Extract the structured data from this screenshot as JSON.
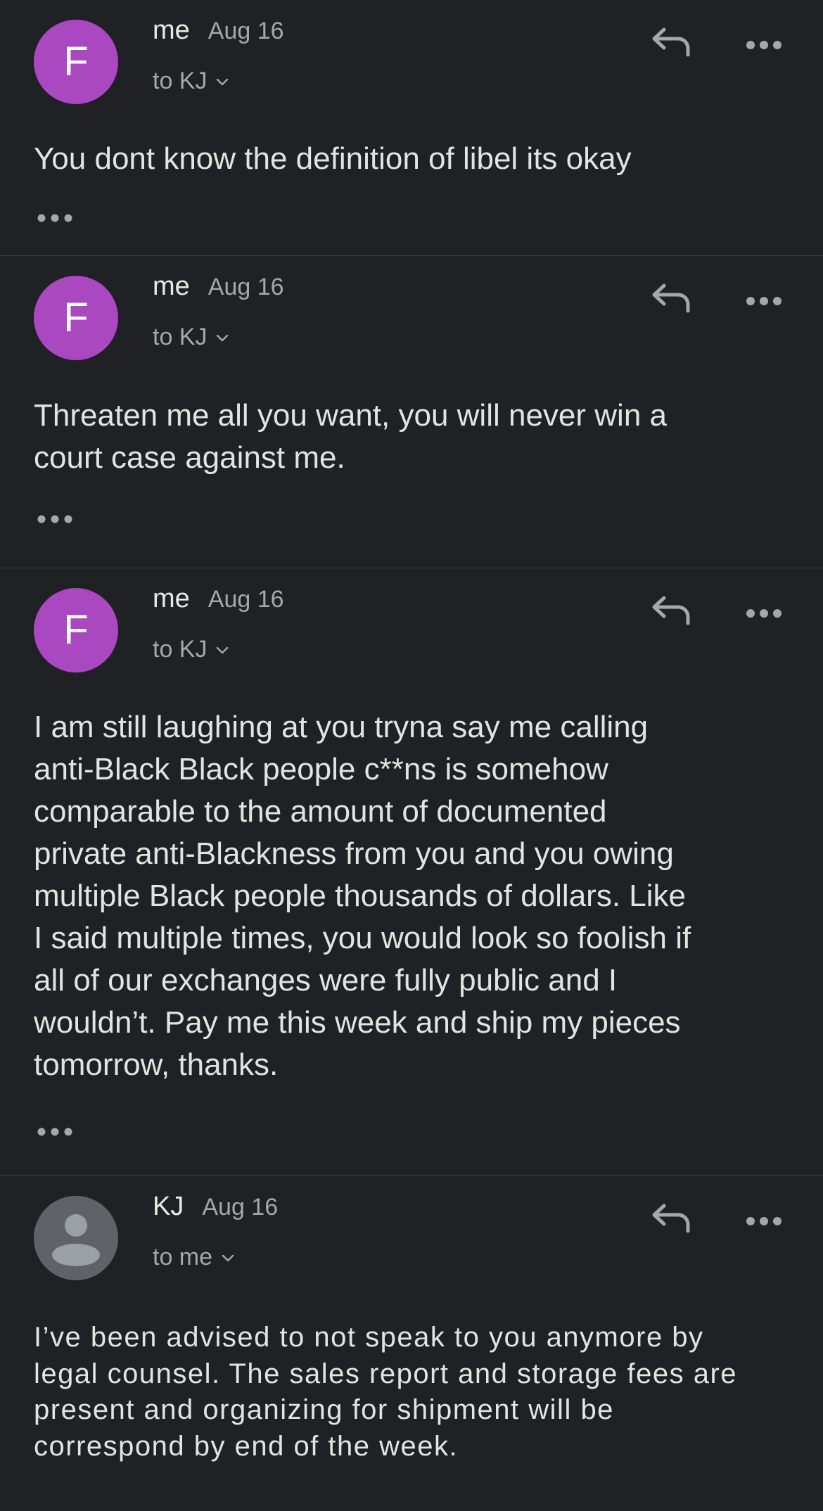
{
  "colors": {
    "background": "#202124",
    "avatar_me": "#a948c0",
    "avatar_unknown": "#5f6368",
    "divider": "#3c3d40",
    "secondary_text": "#a6a7aa"
  },
  "icons": {
    "reply": "reply-arrow-icon",
    "more": "more-horizontal-icon",
    "chevron": "chevron-down-icon",
    "expand": "show-trimmed-content-icon",
    "person": "person-silhouette-icon"
  },
  "messages": [
    {
      "avatar_letter": "F",
      "sender": "me",
      "date": "Aug 16",
      "recipient": "to KJ",
      "body": "You dont know the definition of libel its okay"
    },
    {
      "avatar_letter": "F",
      "sender": "me",
      "date": "Aug 16",
      "recipient": "to KJ",
      "body": "Threaten me all you want, you will never win a\ncourt case against me."
    },
    {
      "avatar_letter": "F",
      "sender": "me",
      "date": "Aug 16",
      "recipient": "to KJ",
      "body": "I am still laughing at you tryna say me calling\nanti-Black Black people c**ns is somehow\ncomparable to the amount of documented\nprivate anti-Blackness from you and you owing\nmultiple Black people thousands of dollars. Like\nI said multiple times, you would look so foolish if\nall of our exchanges were fully public and I\nwouldn’t. Pay me this week and ship my pieces\ntomorrow, thanks."
    },
    {
      "sender": "KJ",
      "date": "Aug 16",
      "recipient": "to me",
      "body": "I’ve been advised to not speak to you anymore by\nlegal counsel. The sales report and storage fees are\npresent and organizing for shipment will be\ncorrespond by end of the week."
    }
  ]
}
